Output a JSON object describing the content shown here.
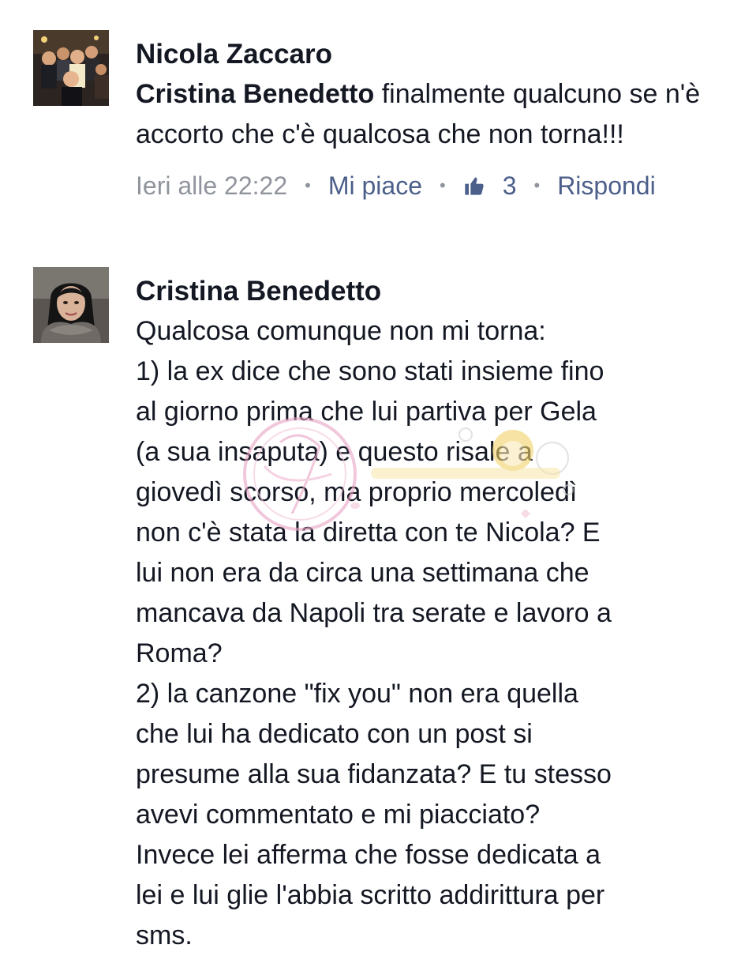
{
  "comments": [
    {
      "author": "Nicola Zaccaro",
      "mention": "Cristina Benedetto",
      "text": " finalmente qualcuno se n'è accorto che c'è qualcosa che non torna!!!",
      "timestamp": "Ieri alle 22:22",
      "like_action": "Mi piace",
      "like_count": "3",
      "reply_action": "Rispondi",
      "avatar_icon": "group-photo-avatar"
    },
    {
      "author": "Cristina Benedetto",
      "lines": [
        "Qualcosa comunque non mi torna:",
        "1) la ex dice che sono stati insieme fino",
        "al giorno prima che lui partiva per Gela",
        "(a sua insaputa) e questo risale a",
        "giovedì scorso, ma proprio mercoledì",
        "non c'è stata la diretta con te Nicola? E",
        "lui non era da circa una settimana che",
        "mancava da Napoli tra serate e lavoro a",
        "Roma?",
        "2) la canzone \"fix you\" non era quella",
        "che lui ha dedicato con un post si",
        "presume alla sua fidanzata? E tu stesso",
        "avevi commentato e mi piacciato?",
        "Invece lei afferma che fosse dedicata a",
        "lei e lui glie l'abbia scritto addirittura per",
        "sms."
      ],
      "avatar_icon": "profile-photo-avatar"
    }
  ],
  "colors": {
    "text": "#141823",
    "meta": "#90949c",
    "action": "#4b5f8a",
    "watermark_pink": "#e8a3c4",
    "watermark_yellow": "#f2d36b"
  },
  "watermark_icon": "blog-watermark-logo"
}
